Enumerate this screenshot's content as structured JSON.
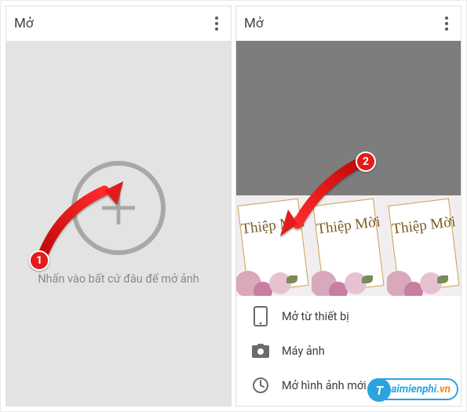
{
  "left": {
    "title": "Mở",
    "hint": "Nhấn vào bất cứ đâu để mở ảnh"
  },
  "right": {
    "title": "Mở",
    "thumbs": {
      "card_text": "Thiệp Mời"
    },
    "options": {
      "devices": "Mở từ thiết bị",
      "camera": "Máy ảnh",
      "latest": "Mở hình ảnh mới nhất"
    }
  },
  "annotations": {
    "badge1": "1",
    "badge2": "2"
  },
  "watermark": {
    "text": "aimienphi",
    "suffix": ".vn",
    "letter": "T"
  }
}
